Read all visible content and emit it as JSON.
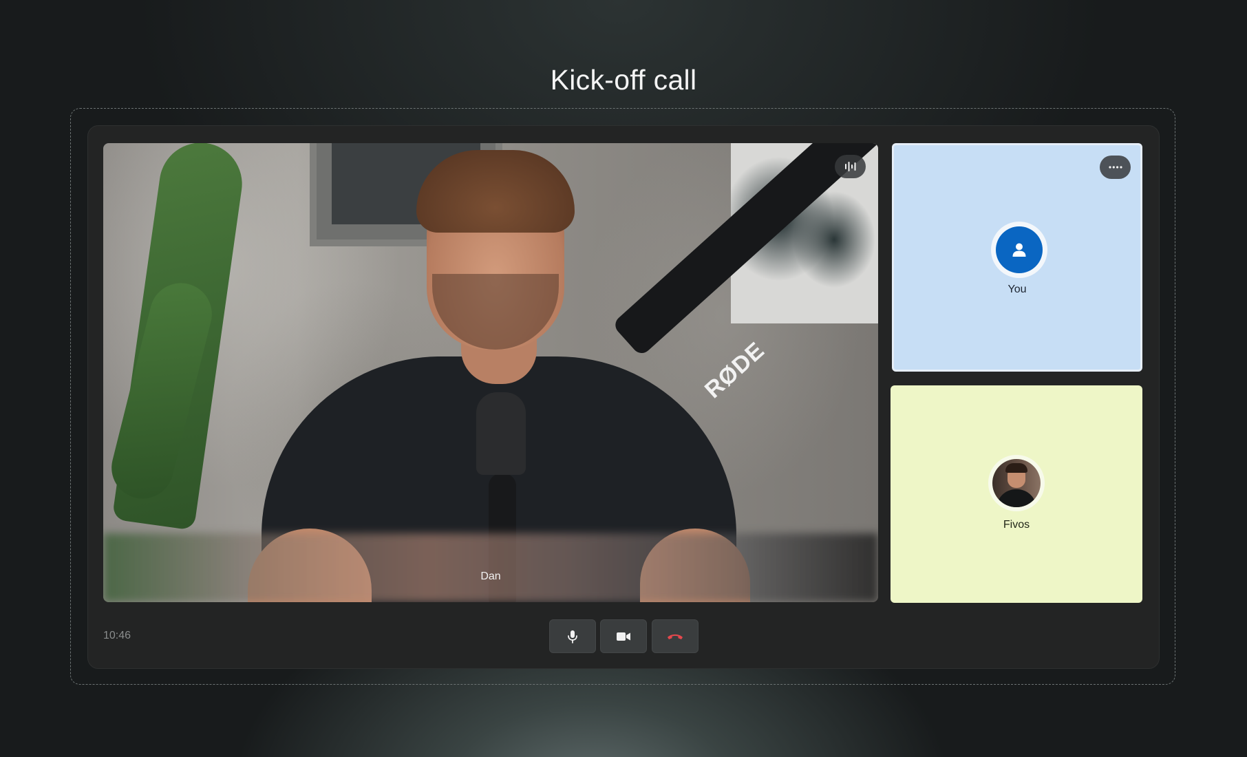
{
  "page": {
    "title": "Kick-off call"
  },
  "main_video": {
    "participant_name": "Dan",
    "audio_icon": "audio-waveform-icon",
    "mic_brand_text": "RØDE"
  },
  "tiles": [
    {
      "participant_name": "You",
      "avatar": "user-icon",
      "background": "#c7def5",
      "menu_icon": "more-dots-icon"
    },
    {
      "participant_name": "Fivos",
      "avatar": "photo",
      "background": "#eef6c7"
    }
  ],
  "controls": {
    "time": "10:46",
    "mic_icon": "microphone-icon",
    "camera_icon": "video-camera-icon",
    "end_call_icon": "hang-up-icon",
    "end_call_color": "#e5484d"
  },
  "colors": {
    "accent": "#0a66c2",
    "background": "#181b1c",
    "window": "#232424"
  }
}
